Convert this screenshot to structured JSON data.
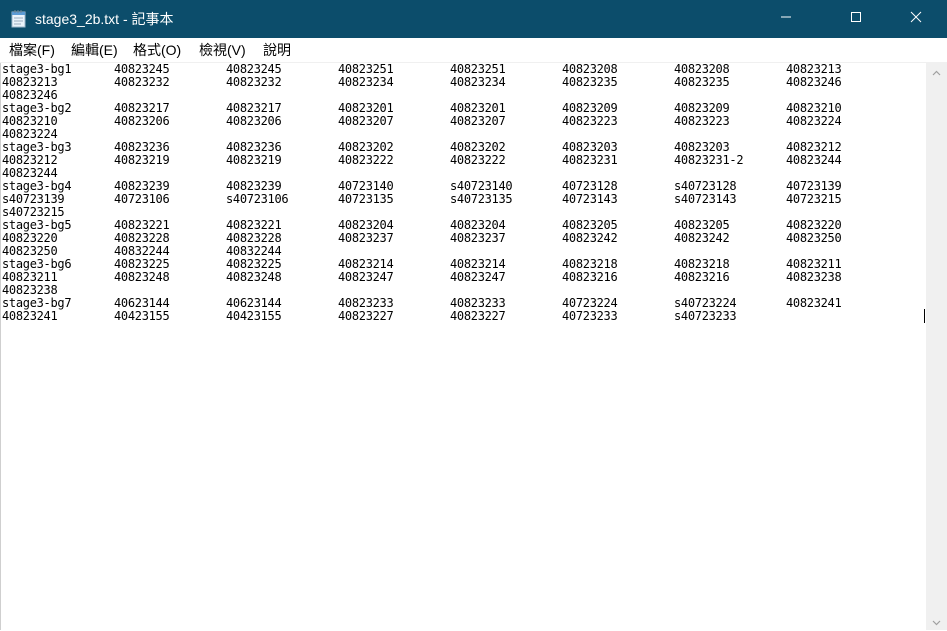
{
  "window": {
    "title": "stage3_2b.txt - 記事本",
    "controls": {
      "minimize": "minimize",
      "maximize": "maximize",
      "close": "close"
    }
  },
  "menu": [
    "檔案(F)",
    "編輯(E)",
    "格式(O)",
    "檢視(V)",
    "說明"
  ],
  "lines": [
    [
      "stage3-bg1",
      "40823245",
      "40823245",
      "40823251",
      "40823251",
      "40823208",
      "40823208",
      "40823213"
    ],
    [
      "40823213",
      "40823232",
      "40823232",
      "40823234",
      "40823234",
      "40823235",
      "40823235",
      "40823246"
    ],
    [
      "40823246"
    ],
    [
      "stage3-bg2",
      "40823217",
      "40823217",
      "40823201",
      "40823201",
      "40823209",
      "40823209",
      "40823210"
    ],
    [
      "40823210",
      "40823206",
      "40823206",
      "40823207",
      "40823207",
      "40823223",
      "40823223",
      "40823224"
    ],
    [
      "40823224"
    ],
    [
      "stage3-bg3",
      "40823236",
      "40823236",
      "40823202",
      "40823202",
      "40823203",
      "40823203",
      "40823212"
    ],
    [
      "40823212",
      "40823219",
      "40823219",
      "40823222",
      "40823222",
      "40823231",
      "40823231-2",
      "40823244"
    ],
    [
      "40823244"
    ],
    [
      "stage3-bg4",
      "40823239",
      "40823239",
      "40723140",
      "s40723140",
      "40723128",
      "s40723128",
      "40723139"
    ],
    [
      "s40723139",
      "40723106",
      "s40723106",
      "40723135",
      "s40723135",
      "40723143",
      "s40723143",
      "40723215"
    ],
    [
      "s40723215"
    ],
    [
      "stage3-bg5",
      "40823221",
      "40823221",
      "40823204",
      "40823204",
      "40823205",
      "40823205",
      "40823220"
    ],
    [
      "40823220",
      "40823228",
      "40823228",
      "40823237",
      "40823237",
      "40823242",
      "40823242",
      "40823250"
    ],
    [
      "40823250",
      "40832244",
      "40832244"
    ],
    [
      "stage3-bg6",
      "40823225",
      "40823225",
      "40823214",
      "40823214",
      "40823218",
      "40823218",
      "40823211"
    ],
    [
      "40823211",
      "40823248",
      "40823248",
      "40823247",
      "40823247",
      "40823216",
      "40823216",
      "40823238"
    ],
    [
      "40823238"
    ],
    [
      "stage3-bg7",
      "40623144",
      "40623144",
      "40823233",
      "40823233",
      "40723224",
      "s40723224",
      "40823241"
    ],
    [
      "40823241",
      "40423155",
      "40423155",
      "40823227",
      "40823227",
      "40723233",
      "s40723233"
    ]
  ],
  "colors": {
    "titlebar": "#0c4d6b",
    "editor_bg": "#ffffff",
    "text": "#000000"
  }
}
